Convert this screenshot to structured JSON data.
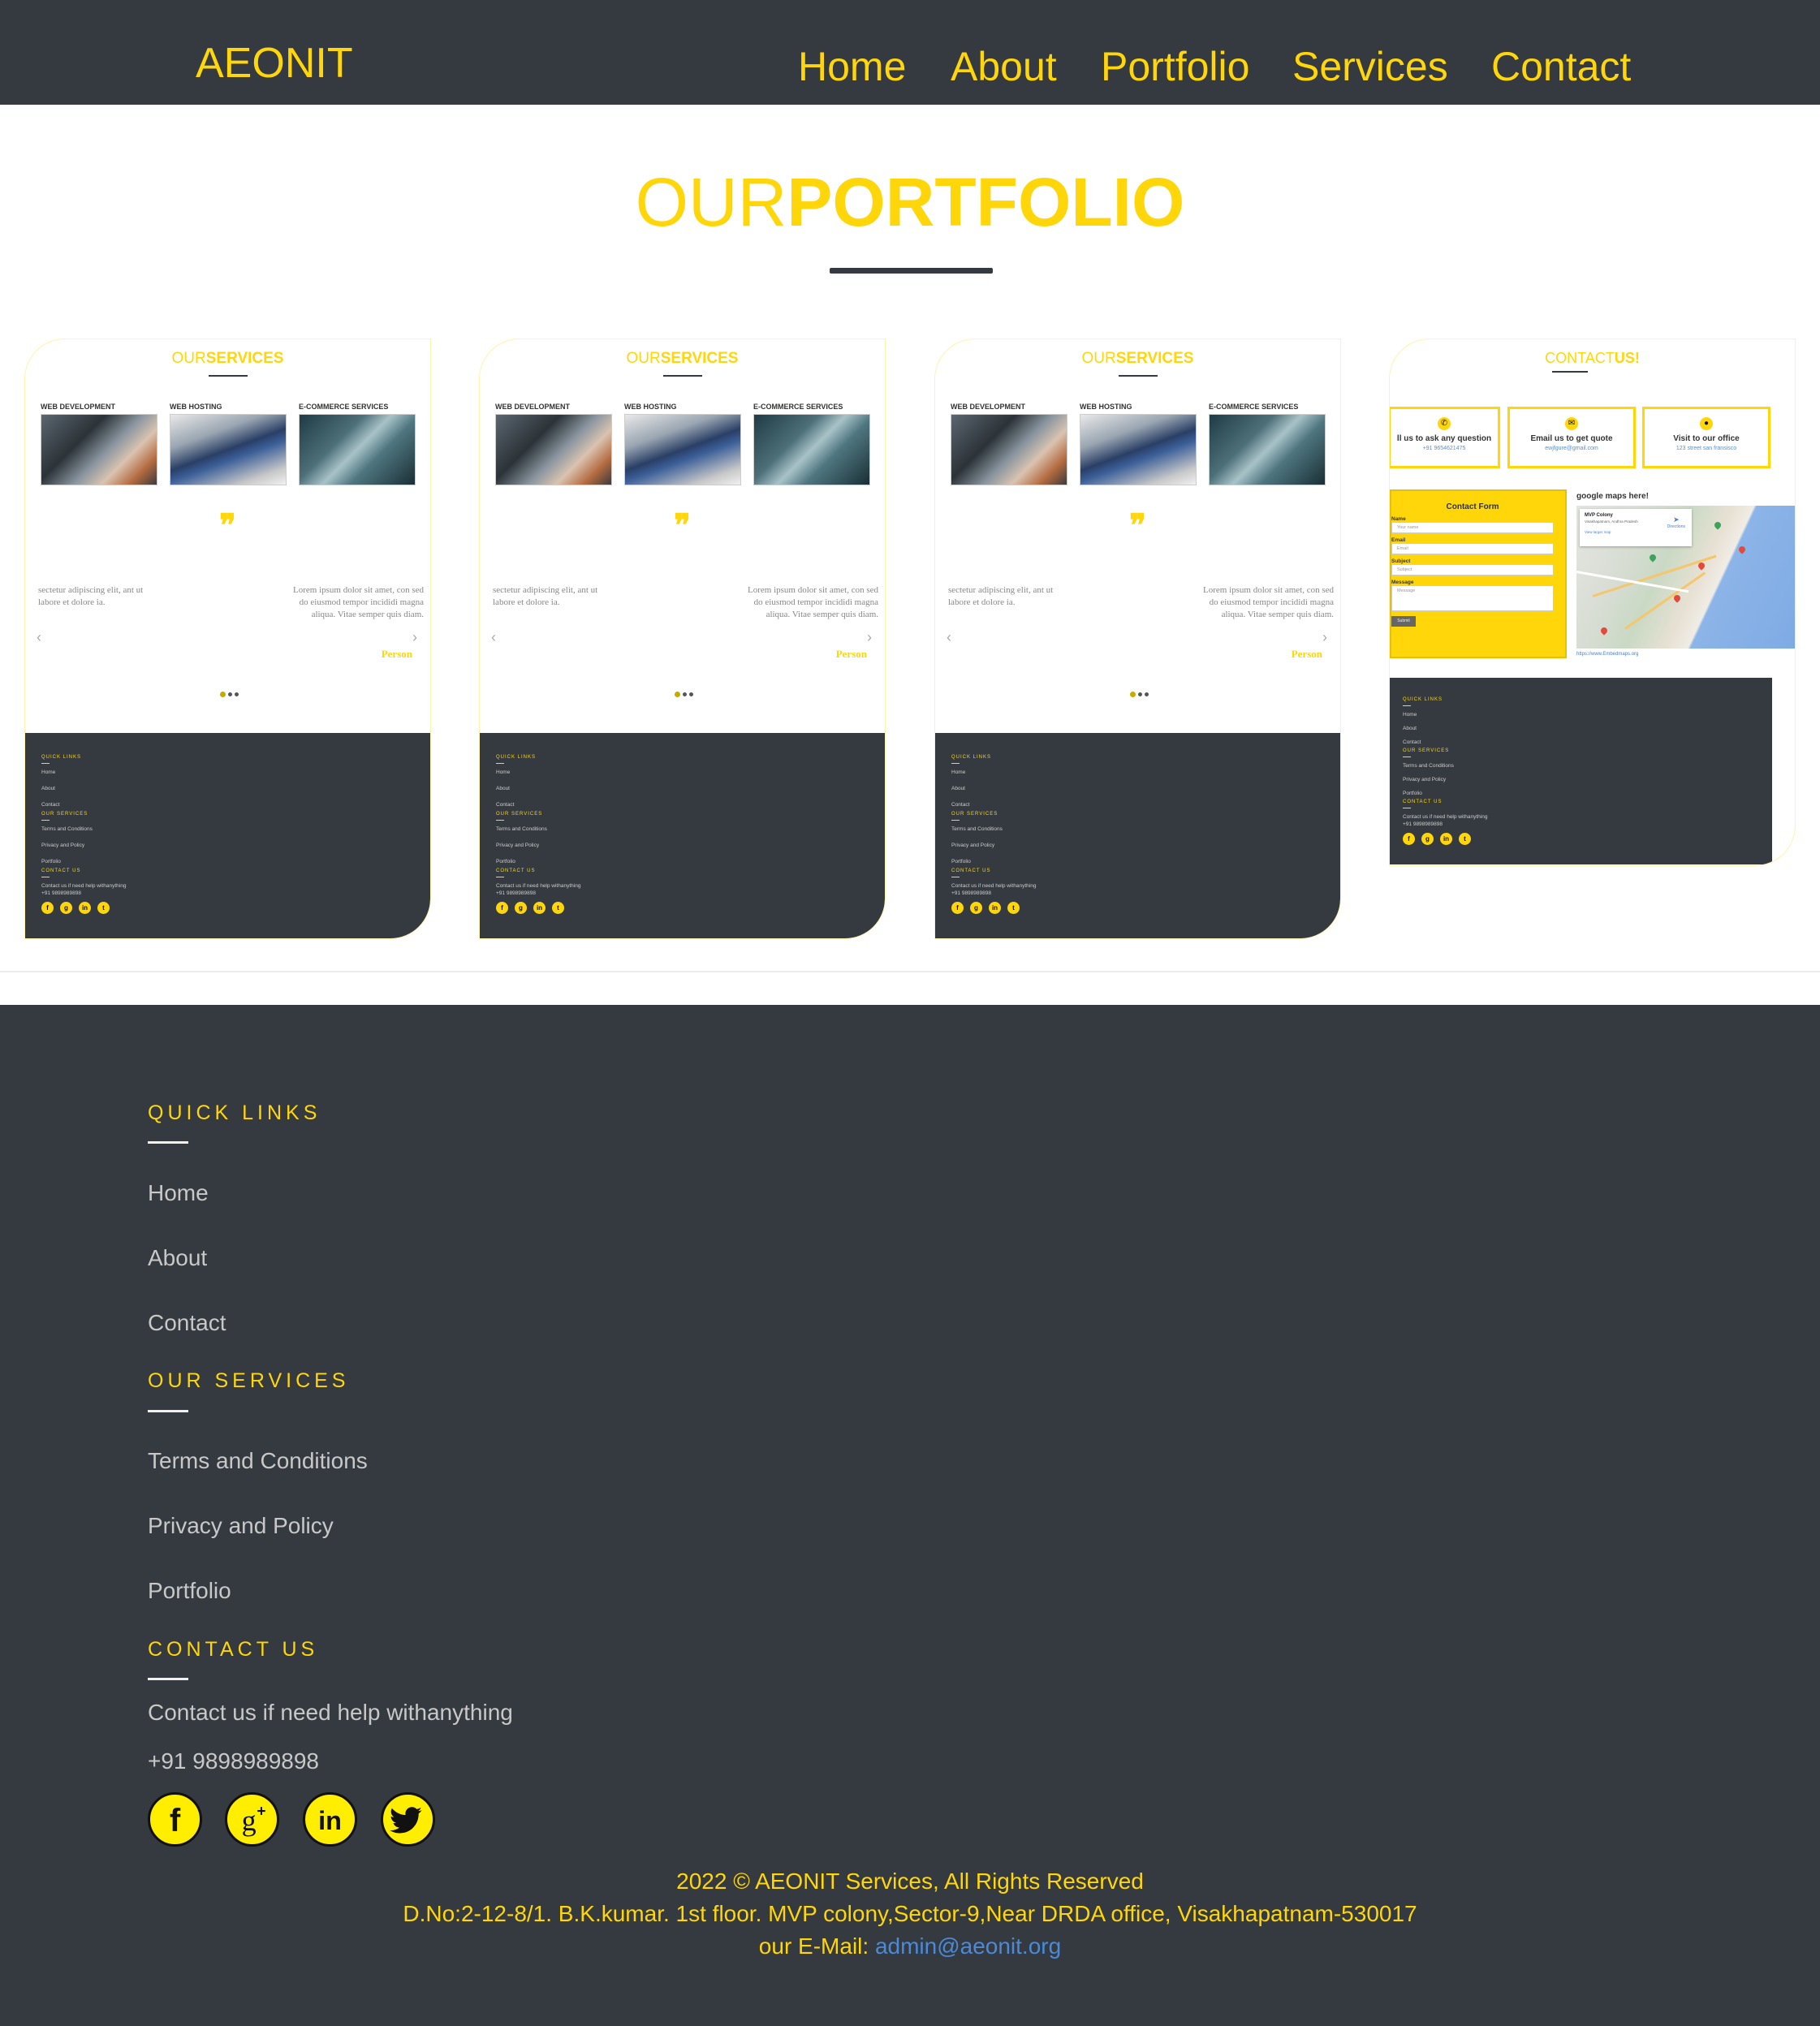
{
  "nav": {
    "brand": "AEONIT",
    "items": [
      "Home",
      "About",
      "Portfolio",
      "Services",
      "Contact"
    ]
  },
  "portfolio": {
    "title_light": "OUR",
    "title_bold": "PORTFOLIO"
  },
  "thumb_services": {
    "head_light": "OUR",
    "head_bold": "SERVICES",
    "cols": [
      "WEB DEVELOPMENT",
      "WEB HOSTING",
      "E-COMMERCE SERVICES"
    ],
    "quote_mark": "❞",
    "left_text": "sectetur adipiscing elit, ant ut labore et dolore ia.",
    "right_text": "Lorem ipsum dolor sit amet, con sed do eiusmod tempor incididi magna aliqua. Vitae semper quis diam.",
    "person": "Person",
    "footer": {
      "quick_links": "QUICK LINKS",
      "links": [
        "Home",
        "About",
        "Contact"
      ],
      "our_services": "OUR SERVICES",
      "services": [
        "Terms and Conditions",
        "Privacy and Policy",
        "Portfolio"
      ],
      "contact_us": "CONTACT US",
      "contact_text": "Contact us if need help withanything",
      "phone": "+91 9898989898"
    }
  },
  "thumb_contact": {
    "head_light": "CONTACT",
    "head_bold": "US!",
    "boxes": [
      {
        "title": "ll us to ask any question",
        "sub": "+91 9654621475"
      },
      {
        "title": "Email us to get quote",
        "sub": "ewjfgure@gmail.com"
      },
      {
        "title": "Visit to our office",
        "sub": "123 street san fransisco"
      }
    ],
    "form_title": "Contact Form",
    "fields": [
      {
        "label": "Name",
        "placeholder": "Your name"
      },
      {
        "label": "Email",
        "placeholder": "Email"
      },
      {
        "label": "Subject",
        "placeholder": "Subject"
      },
      {
        "label": "Message",
        "placeholder": "Message"
      }
    ],
    "submit": "Submit",
    "map_title": "google maps here!",
    "map_place": "MVP Colony",
    "map_address": "Visakhapatnam, Andhra Pradesh",
    "map_link_text": "View larger map",
    "map_directions": "Directions",
    "map_url": "https://www.Embedmaps.org"
  },
  "footer": {
    "quick_links": "QUICK LINKS",
    "links": [
      "Home",
      "About",
      "Contact"
    ],
    "our_services": "OUR SERVICES",
    "services": [
      "Terms and Conditions",
      "Privacy and Policy",
      "Portfolio"
    ],
    "contact_us": "CONTACT US",
    "contact_text": "Contact us if need help withanything",
    "phone": "+91 9898989898",
    "social": [
      "facebook-icon",
      "google-plus-icon",
      "linkedin-icon",
      "twitter-icon"
    ],
    "copyright": "2022 © AEONIT Services, All Rights Reserved",
    "address": "D.No:2-12-8/1. B.K.kumar. 1st floor. MVP colony,Sector-9,Near DRDA office, Visakhapatnam-530017",
    "email_label": "our E-Mail: ",
    "email": "admin@aeonit.org"
  },
  "colors": {
    "accent": "#ffd60a",
    "dark": "#343a40",
    "link_blue": "#4a8ad8"
  }
}
